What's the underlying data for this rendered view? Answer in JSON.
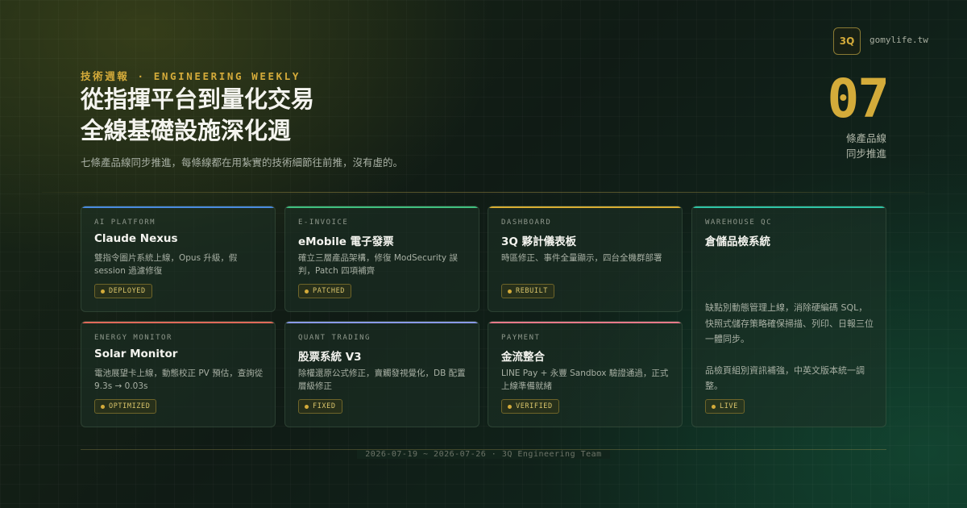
{
  "header": {
    "kicker": "技術週報 · ENGINEERING WEEKLY",
    "title_line1": "從指揮平台到量化交易",
    "title_line2": "全線基礎設施深化週",
    "subtitle": "七條產品線同步推進，每條線都在用紮實的技術細節往前推，沒有虛的。"
  },
  "brand": {
    "logo": "3Q",
    "domain": "gomylife.tw"
  },
  "stat": {
    "value": "07",
    "label_line1": "條產品線",
    "label_line2": "同步推進"
  },
  "cards": [
    {
      "category": "AI PLATFORM",
      "title": "Claude Nexus",
      "description": "雙指令圖片系統上線，Opus 升級，假 session 過濾修復",
      "badge": "DEPLOYED",
      "accent": "#4a8ae0"
    },
    {
      "category": "E-INVOICE",
      "title": "eMobile 電子發票",
      "description": "確立三層產品架構，修復 ModSecurity 誤判，Patch 四項補齊",
      "badge": "PATCHED",
      "accent": "#3fbf7f"
    },
    {
      "category": "DASHBOARD",
      "title": "3Q 夥計儀表板",
      "description": "時區修正、事件全量顯示，四台全機群部署",
      "badge": "REBUILT",
      "accent": "#d9ad32"
    },
    {
      "category": "WAREHOUSE QC",
      "title": "倉儲品檢系統",
      "description_p1": "缺點別動態管理上線，消除硬編碼 SQL，快照式儲存策略確保掃描、列印、日報三位一體同步。",
      "description_p2": "品檢頁組別資訊補強，中英文版本統一調整。",
      "badge": "LIVE",
      "accent": "#2ec4a6"
    },
    {
      "category": "ENERGY MONITOR",
      "title": "Solar Monitor",
      "description": "電池展望卡上線，動態校正 PV 預估，查詢從 9.3s → 0.03s",
      "badge": "OPTIMIZED",
      "accent": "#e06a5a"
    },
    {
      "category": "QUANT TRADING",
      "title": "股票系統 V3",
      "description": "除權還原公式修正，賣觸發視覺化，DB 配置層級修正",
      "badge": "FIXED",
      "accent": "#8a9ae8"
    },
    {
      "category": "PAYMENT",
      "title": "金流整合",
      "description": "LINE Pay + 永豐 Sandbox 驗證通過，正式上線準備就緒",
      "badge": "VERIFIED",
      "accent": "#e87a8a"
    }
  ],
  "footer": {
    "text": "2026-07-19 ~ 2026-07-26 · 3Q Engineering Team"
  }
}
